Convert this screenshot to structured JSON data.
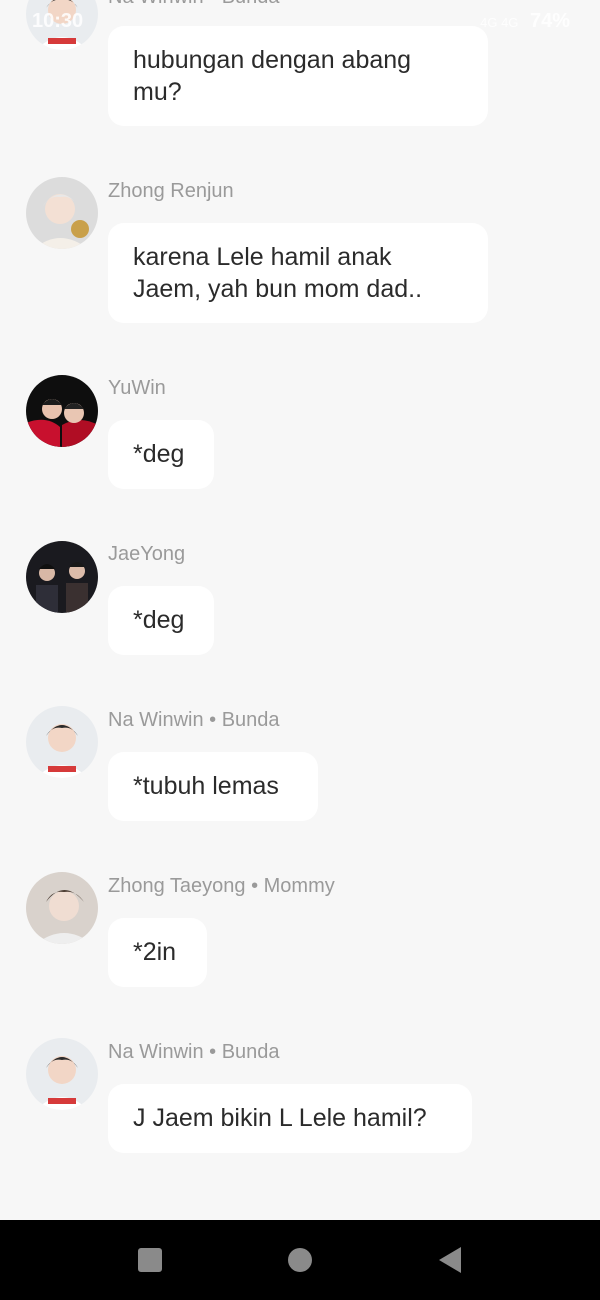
{
  "status_bar": {
    "time": "10:30",
    "network": "4G 4G",
    "battery": "74%"
  },
  "messages": [
    {
      "sender": "Na Winwin • Bunda",
      "text": "hubungan dengan abang mu?",
      "avatar": "winwin-avatar"
    },
    {
      "sender": "Zhong Renjun",
      "text": "karena Lele hamil anak Jaem, yah bun mom dad..",
      "avatar": "renjun-avatar"
    },
    {
      "sender": "YuWin",
      "text": "*deg",
      "avatar": "yuwin-avatar"
    },
    {
      "sender": "JaeYong",
      "text": "*deg",
      "avatar": "jaeyong-avatar"
    },
    {
      "sender": "Na Winwin • Bunda",
      "text": "*tubuh lemas",
      "avatar": "winwin-avatar"
    },
    {
      "sender": "Zhong Taeyong • Mommy",
      "text": "*2in",
      "avatar": "taeyong-avatar"
    },
    {
      "sender": "Na Winwin • Bunda",
      "text": "J Jaem bikin L Lele hamil?",
      "avatar": "winwin-avatar"
    }
  ],
  "nav": {
    "recents": "square-icon",
    "home": "circle-icon",
    "back": "triangle-back-icon"
  },
  "colors": {
    "background": "#f7f7f7",
    "bubble": "#ffffff",
    "sender_text": "#9a9a9a",
    "message_text": "#2b2b2b",
    "nav_bar": "#000000"
  }
}
